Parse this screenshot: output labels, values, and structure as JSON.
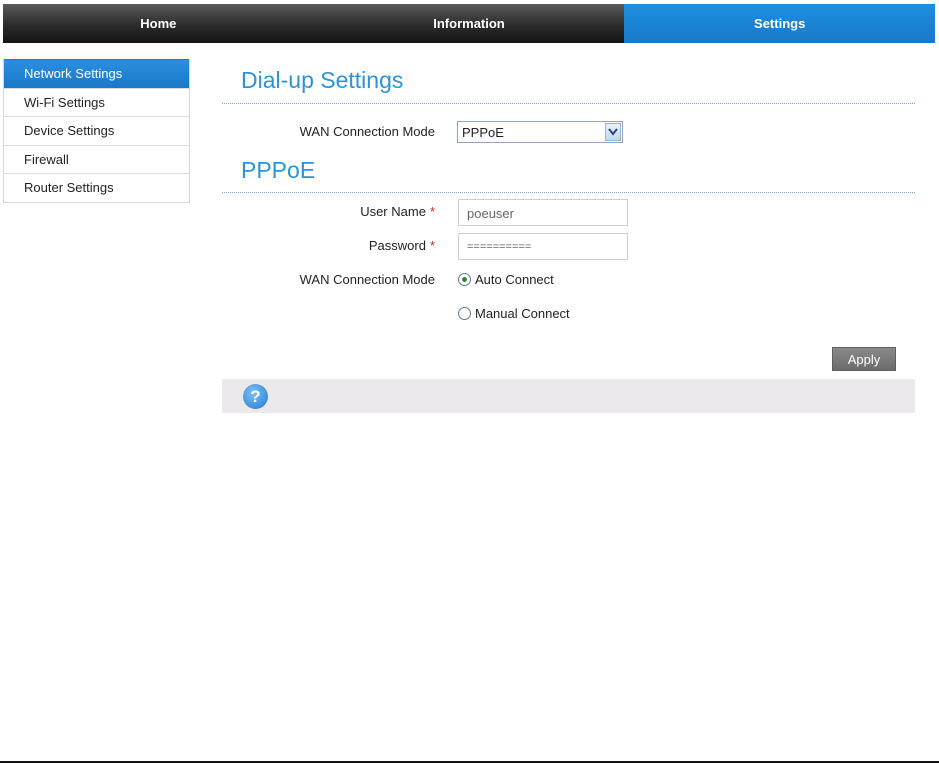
{
  "nav": {
    "tabs": [
      {
        "label": "Home"
      },
      {
        "label": "Information"
      },
      {
        "label": "Settings",
        "active": true
      }
    ]
  },
  "sidebar": {
    "items": [
      {
        "label": "Network Settings",
        "active": true
      },
      {
        "label": "Wi-Fi Settings"
      },
      {
        "label": "Device Settings"
      },
      {
        "label": "Firewall"
      },
      {
        "label": "Router Settings"
      }
    ]
  },
  "dialup": {
    "title": "Dial-up Settings",
    "wan_mode_label": "WAN Connection Mode",
    "wan_mode_value": "PPPoE"
  },
  "pppoe": {
    "title": "PPPoE",
    "username_label": "User Name",
    "username_value": "poeuser",
    "password_label": "Password",
    "password_value": "==========",
    "required_mark": "*",
    "connect_mode_label": "WAN Connection Mode",
    "options": [
      {
        "label": "Auto Connect",
        "selected": true
      },
      {
        "label": "Manual Connect",
        "selected": false
      }
    ]
  },
  "actions": {
    "apply_label": "Apply"
  },
  "help": {
    "icon": "help-icon",
    "glyph": "?"
  },
  "colors": {
    "accent": "#1e86d6",
    "title": "#2c93d8"
  }
}
